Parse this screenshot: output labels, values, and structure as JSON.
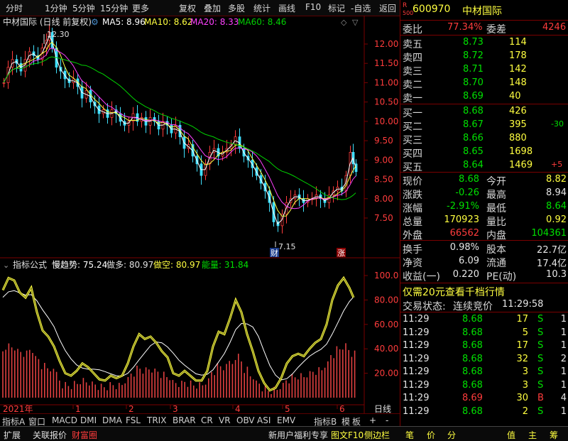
{
  "toolbar": {
    "items": [
      "分时",
      "1分钟",
      "5分钟",
      "15分钟",
      "更多",
      "复权",
      "叠加",
      "多股",
      "统计",
      "画线",
      "F10",
      "标记",
      "-自选",
      "返回"
    ]
  },
  "main_legend": {
    "title": "中材国际 (日线 前复权)",
    "ma5": "MA5: 8.96",
    "ma10": "MA10: 8.62",
    "ma20": "MA20: 8.33",
    "ma60": "MA60: 8.46"
  },
  "price_axis": [
    "12.00",
    "11.50",
    "11.00",
    "10.50",
    "10.00",
    "9.50",
    "9.00",
    "8.50",
    "8.00",
    "7.50"
  ],
  "annotations": {
    "high_label": "12.30",
    "low_label": "7.15",
    "cai_tag": "财",
    "zhang_tag": "涨"
  },
  "ind_legend": {
    "name": "指标公式",
    "slow": "慢趋势: 75.24",
    "bull": "做多: 80.97",
    "short": "做空: 80.97",
    "energy": "能量: 31.84"
  },
  "ind_axis": [
    "100.0",
    "80.00",
    "60.00",
    "40.00",
    "20.00"
  ],
  "time_axis": {
    "year": "2021年",
    "months": [
      "1",
      "2",
      "3",
      "4",
      "5",
      "6"
    ],
    "right": "日线"
  },
  "bottom_tabs": [
    "指标A",
    "窗口",
    "MACD",
    "DMI",
    "DMA",
    "FSL",
    "TRIX",
    "BRAR",
    "CR",
    "VR",
    "OBV",
    "ASI",
    "EMV",
    "指标B",
    "模",
    "板"
  ],
  "footer": {
    "left": [
      "扩展",
      "关联报价",
      "财富圈"
    ],
    "promo": "新用户福利专享",
    "f10": "图文F10",
    "side": "侧边栏",
    "icons": [
      "笔",
      "价",
      "分",
      "值",
      "主",
      "筹"
    ]
  },
  "quote": {
    "code": "600970",
    "name": "中材国际",
    "r_badge": "R",
    "code_sub": "500",
    "weibi_label": "委比",
    "weibi": "77.34%",
    "weicha_label": "委差",
    "weicha": "4246",
    "asks": [
      {
        "label": "卖五",
        "price": "8.73",
        "vol": "114"
      },
      {
        "label": "卖四",
        "price": "8.72",
        "vol": "178"
      },
      {
        "label": "卖三",
        "price": "8.71",
        "vol": "142"
      },
      {
        "label": "卖二",
        "price": "8.70",
        "vol": "148"
      },
      {
        "label": "卖一",
        "price": "8.69",
        "vol": "40"
      }
    ],
    "bids": [
      {
        "label": "买一",
        "price": "8.68",
        "vol": "426",
        "chg": ""
      },
      {
        "label": "买二",
        "price": "8.67",
        "vol": "395",
        "chg": "-30"
      },
      {
        "label": "买三",
        "price": "8.66",
        "vol": "880",
        "chg": ""
      },
      {
        "label": "买四",
        "price": "8.65",
        "vol": "1698",
        "chg": ""
      },
      {
        "label": "买五",
        "price": "8.64",
        "vol": "1469",
        "chg": "+5"
      }
    ],
    "stats": [
      {
        "l1": "现价",
        "v1": "8.68",
        "l2": "今开",
        "v2": "8.82"
      },
      {
        "l1": "涨跌",
        "v1": "-0.26",
        "l2": "最高",
        "v2": "8.94"
      },
      {
        "l1": "涨幅",
        "v1": "-2.91%",
        "l2": "最低",
        "v2": "8.64"
      },
      {
        "l1": "总量",
        "v1": "170923",
        "l2": "量比",
        "v2": "0.92"
      },
      {
        "l1": "外盘",
        "v1": "66562",
        "l2": "内盘",
        "v2": "104361"
      }
    ],
    "stats2": [
      {
        "l1": "换手",
        "v1": "0.98%",
        "l2": "股本",
        "v2": "22.7亿"
      },
      {
        "l1": "净资",
        "v1": "6.09",
        "l2": "流通",
        "v2": "17.4亿"
      },
      {
        "l1": "收益(一)",
        "v1": "0.220",
        "l2": "PE(动)",
        "v2": "10.3"
      }
    ],
    "promo": "仅需20元查看千档行情",
    "trade_state_label": "交易状态:",
    "trade_state": "连续竞价",
    "trade_time": "11:29:58",
    "ticks": [
      {
        "t": "11:29",
        "p": "8.68",
        "v": "17",
        "s": "S",
        "n": "1"
      },
      {
        "t": "11:29",
        "p": "8.68",
        "v": "5",
        "s": "S",
        "n": "1"
      },
      {
        "t": "11:29",
        "p": "8.68",
        "v": "17",
        "s": "S",
        "n": "1"
      },
      {
        "t": "11:29",
        "p": "8.68",
        "v": "32",
        "s": "S",
        "n": "2"
      },
      {
        "t": "11:29",
        "p": "8.68",
        "v": "3",
        "s": "S",
        "n": "1"
      },
      {
        "t": "11:29",
        "p": "8.68",
        "v": "3",
        "s": "S",
        "n": "1"
      },
      {
        "t": "11:29",
        "p": "8.69",
        "v": "30",
        "s": "B",
        "n": "4"
      },
      {
        "t": "11:29",
        "p": "8.68",
        "v": "2",
        "s": "S",
        "n": "1"
      }
    ]
  },
  "colors": {
    "up": "#ff3c3c",
    "down": "#40e0ff",
    "ma5": "#ffffff",
    "ma10": "#ffff40",
    "ma20": "#ff40ff",
    "ma60": "#00d000"
  }
}
